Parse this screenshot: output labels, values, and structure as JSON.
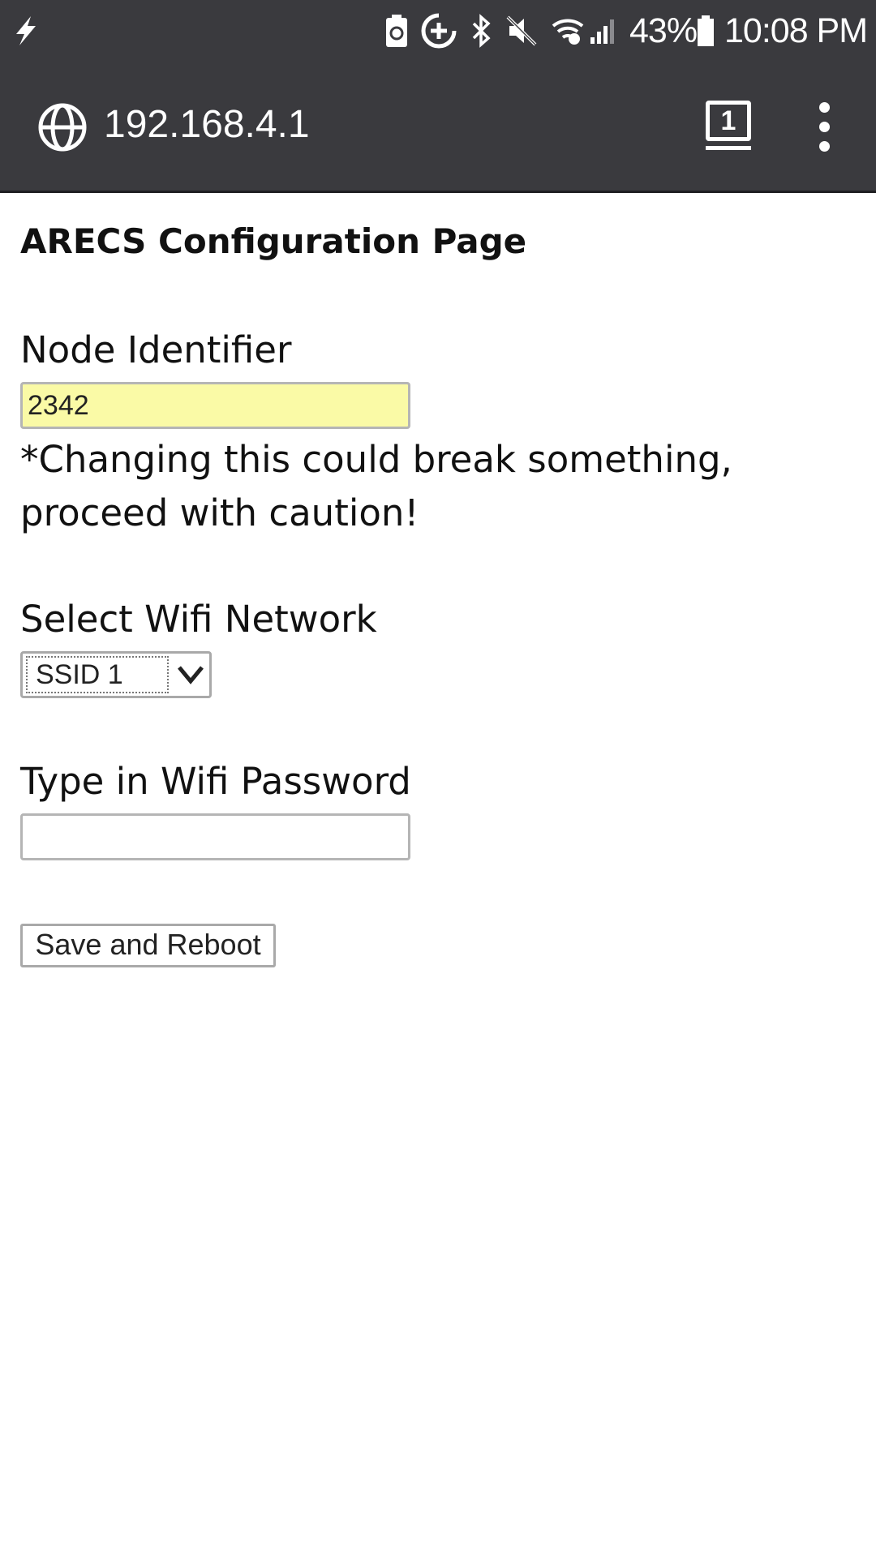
{
  "status_bar": {
    "left_icons": [
      "flash-icon"
    ],
    "right_icons": [
      "battery-saver-icon",
      "data-saver-icon",
      "bluetooth-icon",
      "mute-icon",
      "wifi-icon",
      "cell-signal-icon",
      "battery-icon"
    ],
    "battery_percent": "43%",
    "time": "10:08 PM"
  },
  "browser": {
    "url": "192.168.4.1",
    "tab_count": "1",
    "icons": [
      "globe-icon",
      "tab-count-icon",
      "more-vert-icon"
    ]
  },
  "page": {
    "title": "ARECS Configuration Page",
    "node_identifier": {
      "label": "Node Identifier",
      "value": "2342",
      "caution": "*Changing this could break something, proceed with caution!"
    },
    "wifi_network": {
      "label": "Select Wifi Network",
      "selected": "SSID 1"
    },
    "wifi_password": {
      "label": "Type in Wifi Password",
      "value": ""
    },
    "submit_label": "Save and Reboot"
  },
  "colors": {
    "toolbar_bg": "#3a3a3e",
    "autofill_bg": "#fafaa6"
  }
}
